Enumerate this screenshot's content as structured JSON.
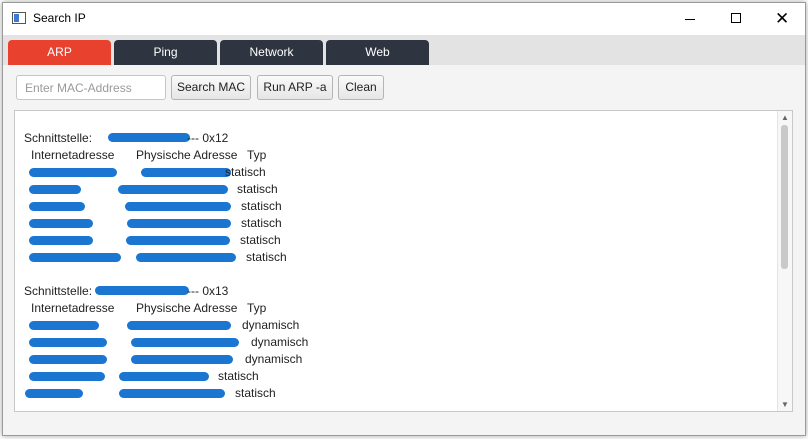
{
  "window": {
    "title": "Search IP"
  },
  "tabs": [
    {
      "label": "ARP",
      "active": true
    },
    {
      "label": "Ping",
      "active": false
    },
    {
      "label": "Network",
      "active": false
    },
    {
      "label": "Web",
      "active": false
    }
  ],
  "toolbar": {
    "mac_placeholder": "Enter MAC-Address",
    "search_label": "Search MAC",
    "run_label": "Run ARP -a",
    "clean_label": "Clean"
  },
  "output": {
    "blocks": [
      {
        "interface_label": "Schnittstelle:",
        "interface_suffix": "--- 0x12",
        "headers": [
          "Internetadresse",
          "Physische Adresse",
          "Typ"
        ],
        "rows": [
          {
            "type": "statisch"
          },
          {
            "type": "statisch"
          },
          {
            "type": "statisch"
          },
          {
            "type": "statisch"
          },
          {
            "type": "statisch"
          },
          {
            "type": "statisch"
          }
        ]
      },
      {
        "interface_label": "Schnittstelle:",
        "interface_suffix": "--- 0x13",
        "headers": [
          "Internetadresse",
          "Physische Adresse",
          "Typ"
        ],
        "rows": [
          {
            "type": "dynamisch"
          },
          {
            "type": "dynamisch"
          },
          {
            "type": "dynamisch"
          },
          {
            "type": "statisch"
          },
          {
            "type": "statisch"
          }
        ]
      }
    ]
  },
  "colors": {
    "accent_tab": "#e8412e",
    "tab_dark": "#2e3440",
    "redaction": "#0f6fd0"
  }
}
